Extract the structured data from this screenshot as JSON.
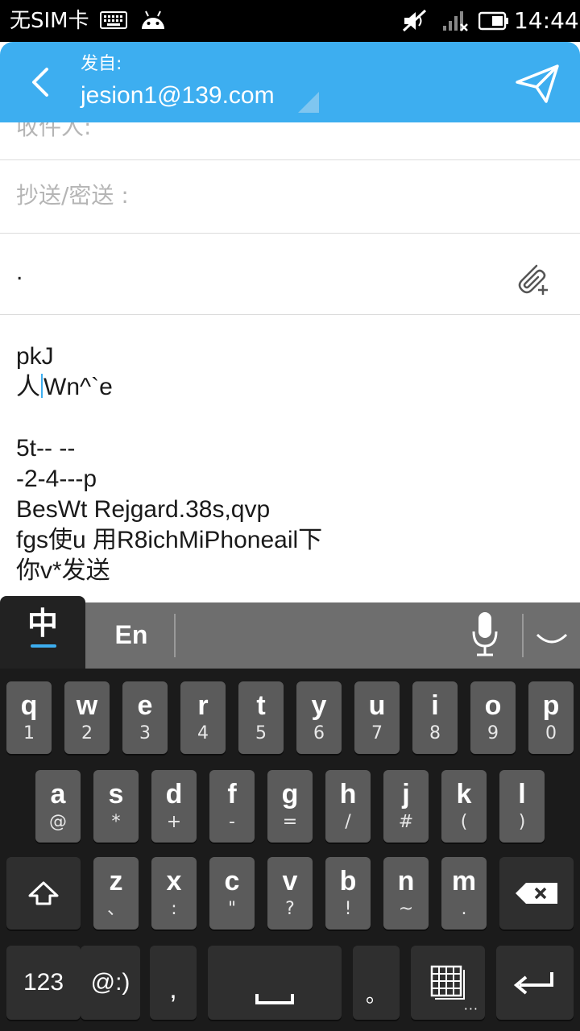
{
  "status_bar": {
    "carrier": "无SIM卡",
    "time": "14:44",
    "icons": [
      "keyboard-icon",
      "android-icon",
      "mute-icon",
      "signal-icon",
      "battery-icon"
    ]
  },
  "header": {
    "from_label": "发自:",
    "from_email": "jesion1@139.com",
    "accent_color": "#3daef0"
  },
  "form": {
    "to_label": "收件人:",
    "cc_label": "抄送/密送 :",
    "subject_value": "."
  },
  "body": {
    "lines": [
      "pkJ",
      "人",
      "Wn^`e",
      "",
      "5t-- --",
      "-2-4---p",
      "BesWt Rejgard.38s,qvp",
      "fgs使u 用R8ichMiPhoneail下",
      "你v*发送"
    ]
  },
  "ime": {
    "zh": "中",
    "en": "En"
  },
  "keyboard": {
    "row1": [
      {
        "main": "q",
        "sub": "1"
      },
      {
        "main": "w",
        "sub": "2"
      },
      {
        "main": "e",
        "sub": "3"
      },
      {
        "main": "r",
        "sub": "4"
      },
      {
        "main": "t",
        "sub": "5"
      },
      {
        "main": "y",
        "sub": "6"
      },
      {
        "main": "u",
        "sub": "7"
      },
      {
        "main": "i",
        "sub": "8"
      },
      {
        "main": "o",
        "sub": "9"
      },
      {
        "main": "p",
        "sub": "0"
      }
    ],
    "row2": [
      {
        "main": "a",
        "sub": "@"
      },
      {
        "main": "s",
        "sub": "*"
      },
      {
        "main": "d",
        "sub": "+"
      },
      {
        "main": "f",
        "sub": "-"
      },
      {
        "main": "g",
        "sub": "="
      },
      {
        "main": "h",
        "sub": "/"
      },
      {
        "main": "j",
        "sub": "#"
      },
      {
        "main": "k",
        "sub": "("
      },
      {
        "main": "l",
        "sub": ")"
      }
    ],
    "row3": [
      {
        "main": "z",
        "sub": "、"
      },
      {
        "main": "x",
        "sub": ":"
      },
      {
        "main": "c",
        "sub": "\""
      },
      {
        "main": "v",
        "sub": "?"
      },
      {
        "main": "b",
        "sub": "!"
      },
      {
        "main": "n",
        "sub": "~"
      },
      {
        "main": "m",
        "sub": "."
      }
    ],
    "num_label": "123",
    "emoji_label": "@:)",
    "comma_label": ",",
    "period_label": "。"
  }
}
